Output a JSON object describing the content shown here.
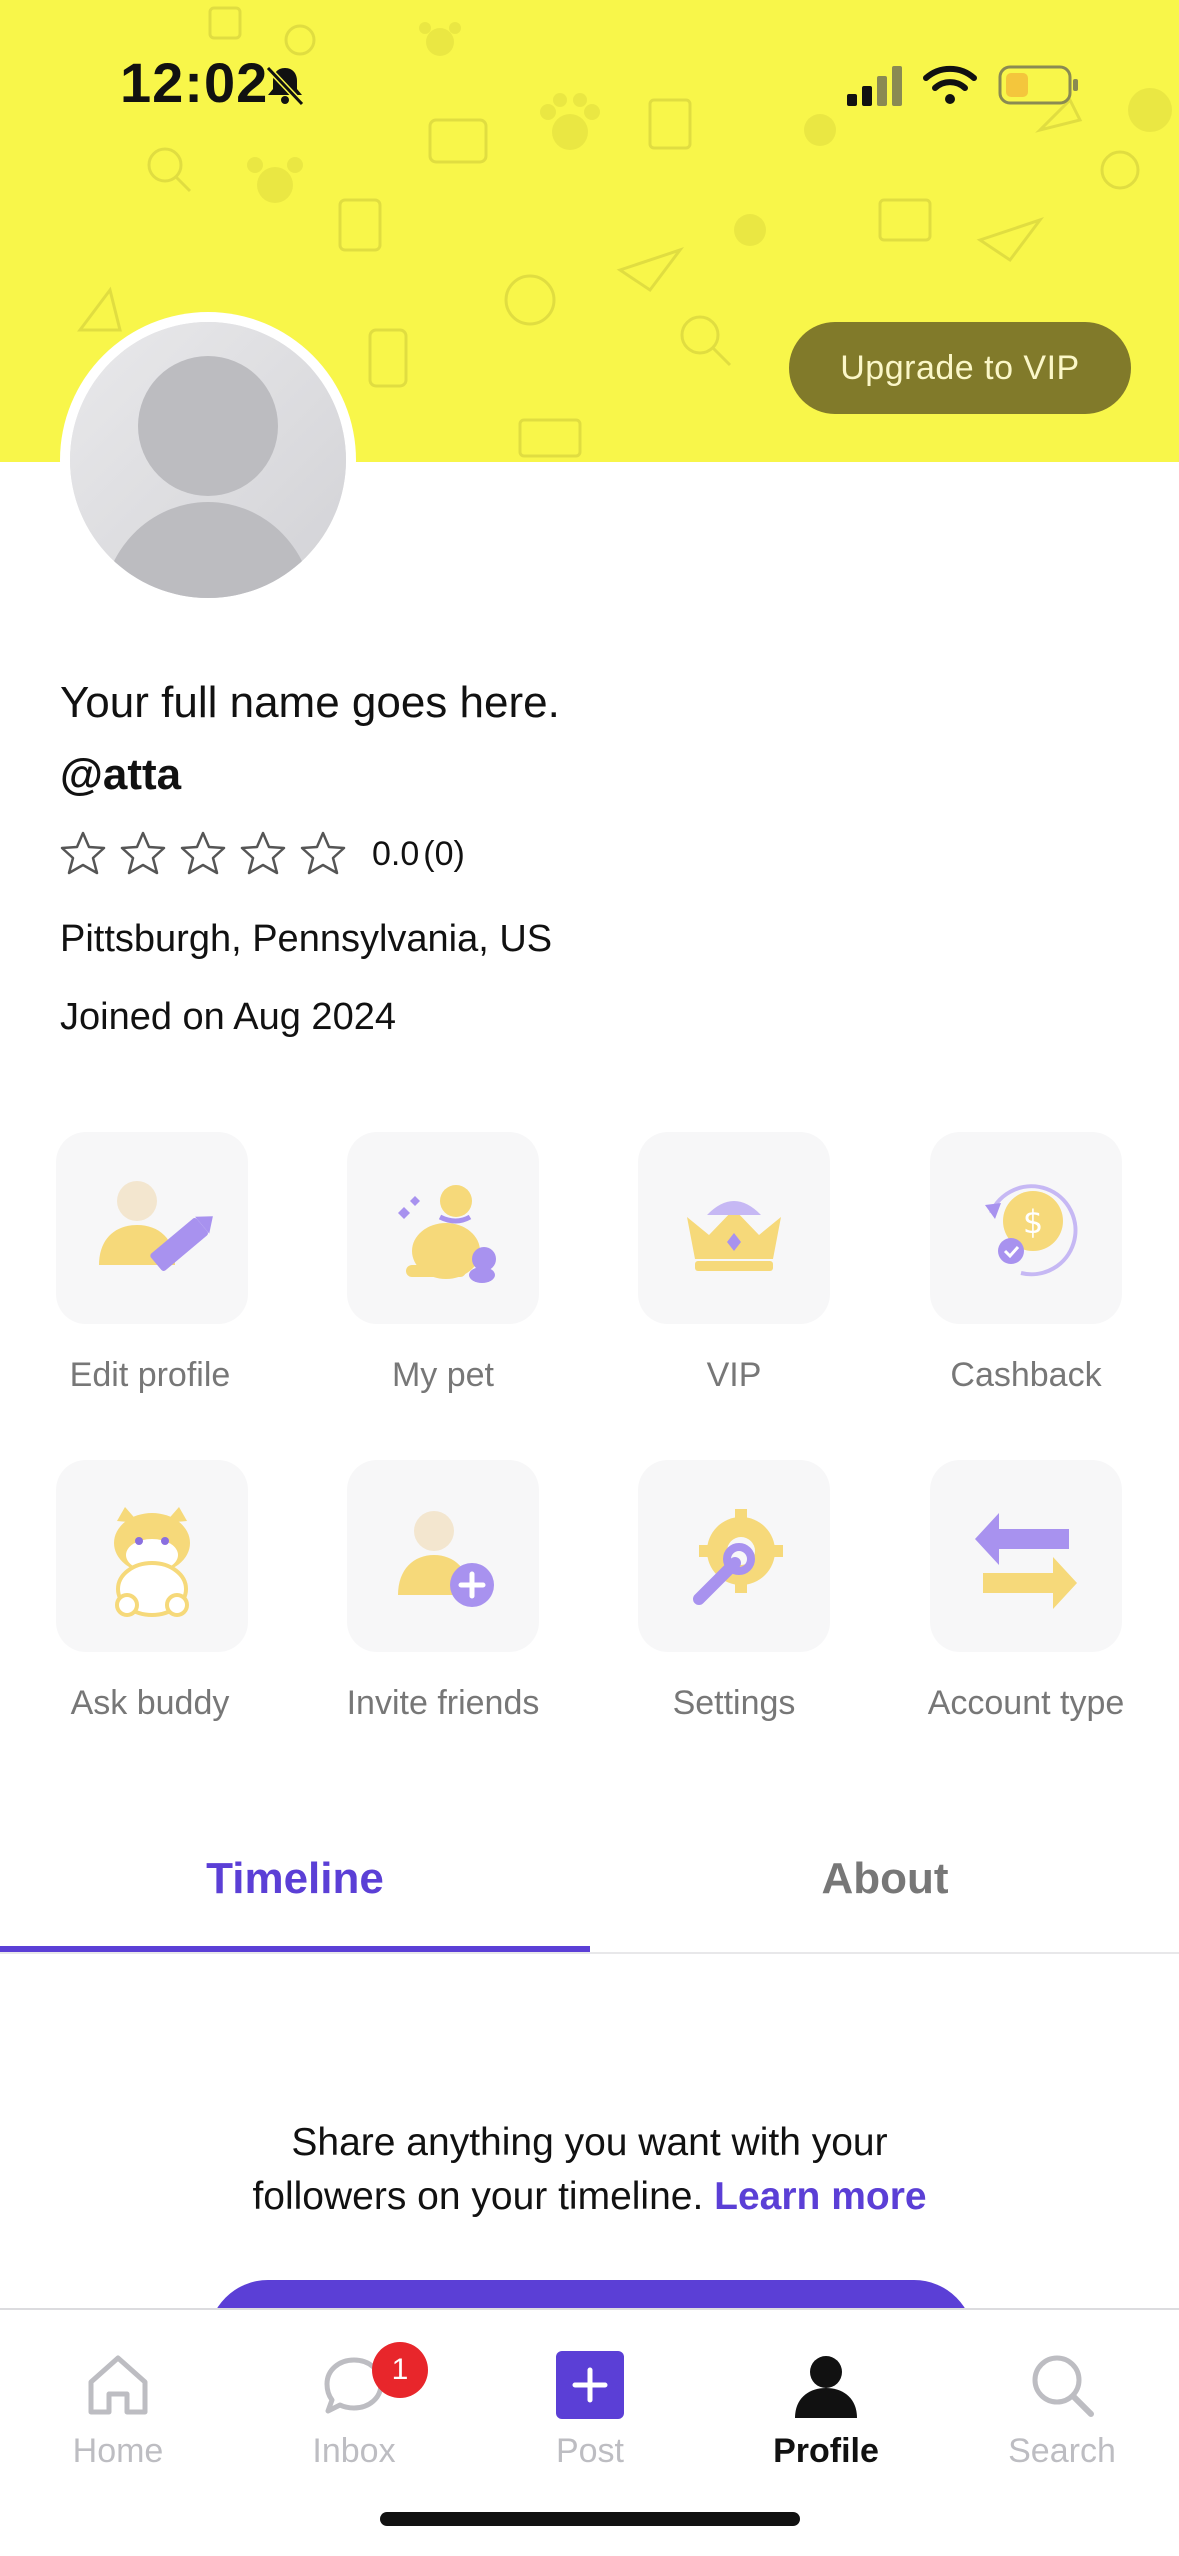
{
  "status_bar": {
    "time": "12:02"
  },
  "header": {
    "upgrade_label": "Upgrade to VIP",
    "banner_color": "#f8f64a"
  },
  "profile": {
    "full_name": "Your full name goes here.",
    "handle": "@atta",
    "rating_value": "0.0",
    "rating_count": "(0)",
    "stars_filled": 0,
    "stars_total": 5,
    "location": "Pittsburgh, Pennsylvania, US",
    "joined": "Joined on Aug 2024"
  },
  "actions": [
    {
      "label": "Edit profile",
      "icon": "edit-profile-icon"
    },
    {
      "label": "My pet",
      "icon": "pet-icon"
    },
    {
      "label": "VIP",
      "icon": "crown-icon"
    },
    {
      "label": "Cashback",
      "icon": "cashback-icon"
    },
    {
      "label": "Ask buddy",
      "icon": "buddy-dog-icon"
    },
    {
      "label": "Invite friends",
      "icon": "add-user-icon"
    },
    {
      "label": "Settings",
      "icon": "settings-icon"
    },
    {
      "label": "Account type",
      "icon": "swap-icon"
    }
  ],
  "tabs": [
    {
      "label": "Timeline",
      "active": true
    },
    {
      "label": "About",
      "active": false
    }
  ],
  "timeline": {
    "line1": "Share anything you want with your",
    "line2": "followers on your timeline.",
    "learn_more": "Learn more"
  },
  "nav": [
    {
      "label": "Home",
      "icon": "home-icon",
      "active": false
    },
    {
      "label": "Inbox",
      "icon": "chat-icon",
      "active": false,
      "badge": "1"
    },
    {
      "label": "Post",
      "icon": "plus-icon",
      "active": false
    },
    {
      "label": "Profile",
      "icon": "person-icon",
      "active": true
    },
    {
      "label": "Search",
      "icon": "search-icon",
      "active": false
    }
  ],
  "colors": {
    "accent": "#5b3fd6",
    "vip_button": "#817a2a",
    "icon_yellow": "#f6d97a",
    "icon_purple": "#a892ef",
    "badge": "#e8262b"
  }
}
